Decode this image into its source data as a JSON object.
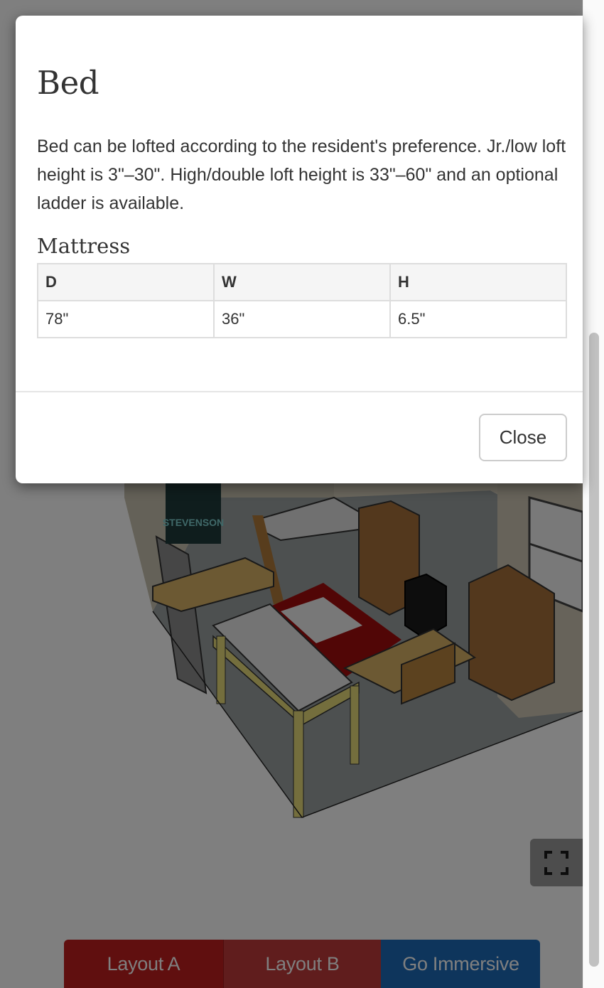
{
  "modal": {
    "title": "Bed",
    "description": "Bed can be lofted according to the resident's preference. Jr./low loft height is 3\"–30\". High/double loft height is 33\"–60\" and an optional ladder is available.",
    "section_title": "Mattress",
    "table": {
      "headers": [
        "D",
        "W",
        "H"
      ],
      "rows": [
        [
          "78\"",
          "36\"",
          "6.5\""
        ]
      ]
    },
    "close_label": "Close"
  },
  "scene": {
    "poster_text": "STEVENSON",
    "fullscreen_icon": "fullscreen-icon"
  },
  "layout_buttons": {
    "layout_a": "Layout A",
    "layout_b": "Layout B",
    "go_immersive": "Go Immersive"
  },
  "colors": {
    "layout_a": "#c11f1f",
    "layout_b": "#c13a3a",
    "go_immersive": "#1d6bb8"
  }
}
